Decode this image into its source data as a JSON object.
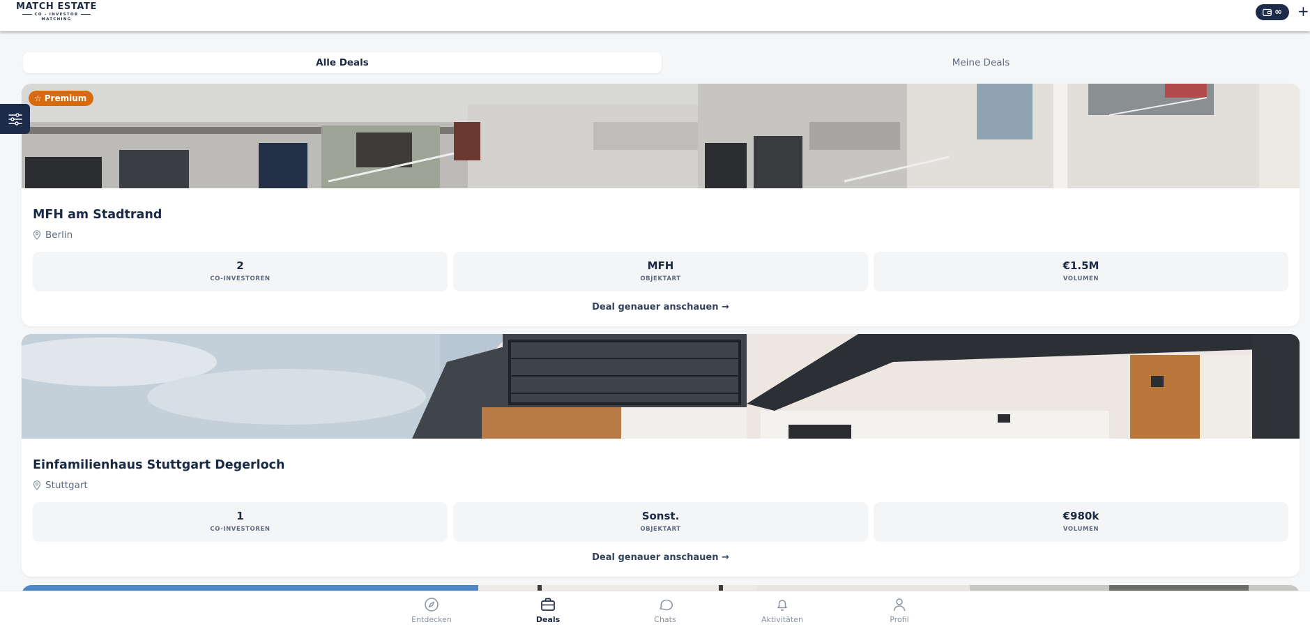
{
  "header": {
    "logo_title": "MATCH ESTATE",
    "logo_sub1": "CO - INVESTOR",
    "logo_sub2": "MATCHING",
    "wallet_value": "∞",
    "plus_label": "+"
  },
  "tabs": [
    {
      "label": "Alle Deals",
      "active": true
    },
    {
      "label": "Meine Deals",
      "active": false
    }
  ],
  "filter": {
    "icon": "sliders-icon"
  },
  "deals": [
    {
      "badge": "Premium",
      "title": "MFH am Stadtrand",
      "location": "Berlin",
      "stats": [
        {
          "value": "2",
          "label": "CO-INVESTOREN"
        },
        {
          "value": "MFH",
          "label": "OBJEKTART"
        },
        {
          "value": "€1.5M",
          "label": "VOLUMEN"
        }
      ],
      "link": "Deal genauer anschauen →"
    },
    {
      "badge": "",
      "title": "Einfamilienhaus Stuttgart Degerloch",
      "location": "Stuttgart",
      "stats": [
        {
          "value": "1",
          "label": "CO-INVESTOREN"
        },
        {
          "value": "Sonst.",
          "label": "OBJEKTART"
        },
        {
          "value": "€980k",
          "label": "VOLUMEN"
        }
      ],
      "link": "Deal genauer anschauen →"
    }
  ],
  "bottom_nav": [
    {
      "label": "Entdecken",
      "icon": "compass-icon",
      "active": false
    },
    {
      "label": "Deals",
      "icon": "briefcase-icon",
      "active": true
    },
    {
      "label": "Chats",
      "icon": "chat-icon",
      "active": false
    },
    {
      "label": "Aktivitäten",
      "icon": "bell-icon",
      "active": false
    },
    {
      "label": "Profil",
      "icon": "user-icon",
      "active": false
    }
  ],
  "colors": {
    "brand": "#1c2b4a",
    "premium": "#d96a0c",
    "background": "#f4f6f8"
  }
}
